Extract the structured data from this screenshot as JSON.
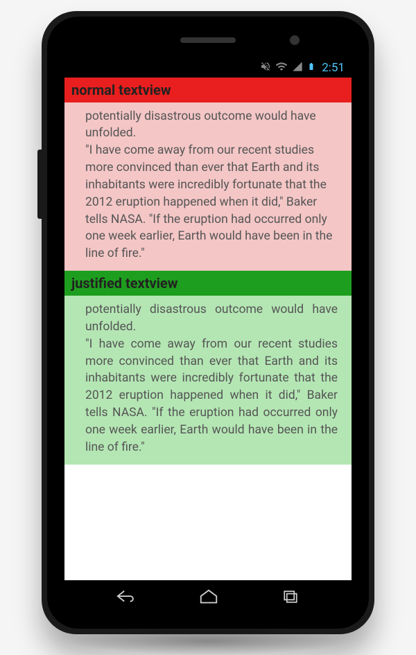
{
  "status_bar": {
    "time": "2:51"
  },
  "sections": {
    "normal": {
      "header": "normal textview",
      "text": "potentially disastrous outcome would have unfolded.\n\"I have come away from our recent studies more convinced than ever that Earth and its inhabitants were incredibly fortunate that the 2012 eruption happened when it did,\" Baker tells NASA. \"If the eruption had occurred only one week earlier, Earth would have been in the line of fire.\""
    },
    "justified": {
      "header": "justified textview",
      "text": "potentially disastrous outcome would have unfolded.\n\"I have come away from our recent studies more convinced than ever that Earth and its inhabitants were incredibly fortunate that the 2012 eruption happened when it did,\" Baker tells NASA. \"If the eruption had occurred only one week earlier, Earth would have been in the line of fire.\""
    }
  },
  "icons": {
    "mute": "mute-icon",
    "wifi": "wifi-icon",
    "signal": "signal-icon",
    "battery": "battery-icon",
    "back": "back-nav",
    "home": "home-nav",
    "recent": "recent-nav"
  }
}
